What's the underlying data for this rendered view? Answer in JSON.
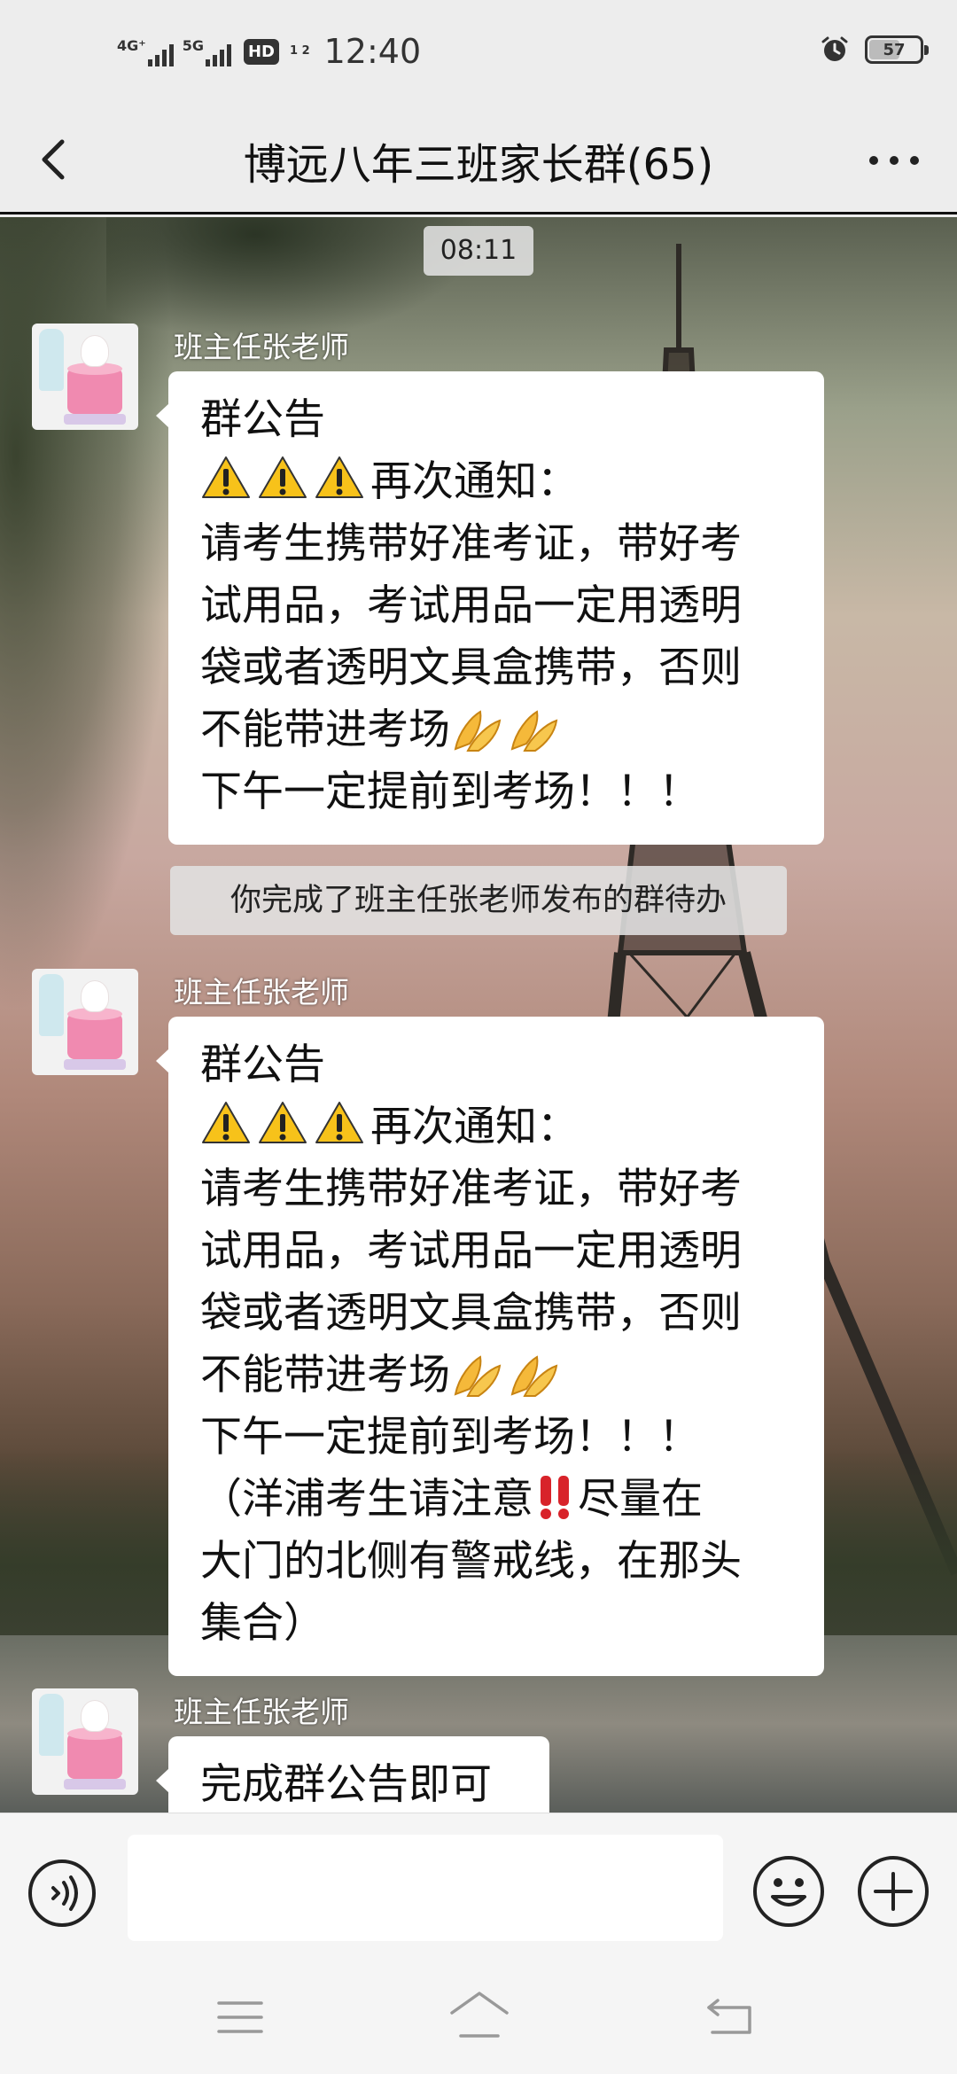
{
  "status_bar": {
    "net1": "4G⁺",
    "net2": "5G",
    "hd": "HD",
    "hd_sub": "1 2",
    "time": "12:40",
    "battery": "57"
  },
  "header": {
    "title": "博远八年三班家长群(65)"
  },
  "chat": {
    "timestamp": "08:11",
    "system_note": "你完成了班主任张老师发布的群待办",
    "messages": [
      {
        "sender": "班主任张老师",
        "lines": [
          "群公告",
          "再次通知：",
          "请考生携带好准考证，带好考",
          "试用品，考试用品一定用透明",
          "袋或者透明文具盒携带，否则",
          "不能带进考场",
          "下午一定提前到考场！！！"
        ]
      },
      {
        "sender": "班主任张老师",
        "lines": [
          "群公告",
          "再次通知：",
          "请考生携带好准考证，带好考",
          "试用品，考试用品一定用透明",
          "袋或者透明文具盒携带，否则",
          "不能带进考场",
          "下午一定提前到考场！！！",
          "（洋浦考生请注意",
          "尽量在",
          "大门的北侧有警戒线，在那头",
          "集合）"
        ]
      },
      {
        "sender": "班主任张老师",
        "lines": [
          "完成群公告即可"
        ]
      }
    ]
  },
  "input": {
    "value": "",
    "placeholder": ""
  },
  "icons": {
    "back": "chevron-left-icon",
    "more": "more-dots-icon",
    "warning": "warning-emoji",
    "hands": "folded-hands-emoji",
    "bangs": "double-exclamation-emoji",
    "voice": "voice-icon",
    "emoji": "emoji-icon",
    "plus": "plus-icon"
  },
  "colors": {
    "bar_bg": "#ededed",
    "bubble": "#ffffff",
    "warning_yellow": "#f7c21a",
    "bangs_red": "#d8232a"
  }
}
